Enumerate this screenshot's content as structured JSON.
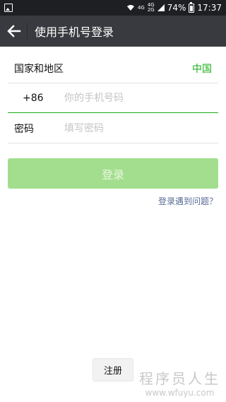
{
  "status_bar": {
    "net_top": "4G",
    "net_bottom": "2G",
    "net2_top": "4G",
    "battery": "74%",
    "time": "17:37"
  },
  "header": {
    "title": "使用手机号登录"
  },
  "form": {
    "country_label": "国家和地区",
    "country_value": "中国",
    "phone_prefix": "+86",
    "phone_placeholder": "你的手机号码",
    "password_label": "密码",
    "password_placeholder": "填写密码"
  },
  "actions": {
    "login_label": "登录",
    "trouble_link": "登录遇到问题？",
    "register_label": "注册"
  },
  "watermark": {
    "title": "程序员人生",
    "url": "www.wfuyu.com"
  },
  "colors": {
    "accent": "#1aad19",
    "login_disabled": "#a2de8d",
    "link": "#576b95",
    "title_bar": "#393a3f",
    "status_bar": "#1e1f22"
  }
}
